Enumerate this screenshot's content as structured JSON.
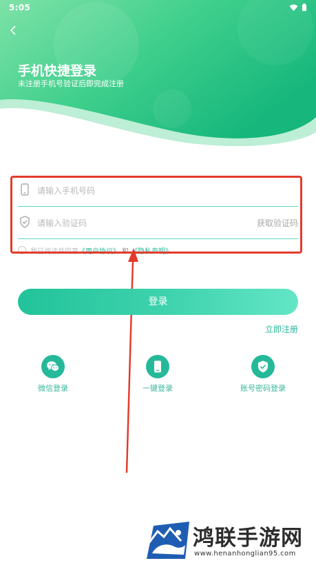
{
  "status_bar": {
    "time": "5:05"
  },
  "header": {
    "title": "手机快捷登录",
    "subtitle": "未注册手机号验证后即完成注册"
  },
  "form": {
    "phone_placeholder": "请输入手机号码",
    "code_placeholder": "请输入验证码",
    "get_code_label": "获取验证码",
    "agreement": {
      "prefix": "我已阅读并同意",
      "user_agreement": "《用户协议》",
      "and": "和",
      "privacy": "《隐私声明》"
    }
  },
  "actions": {
    "login_label": "登录",
    "register_label": "立即注册"
  },
  "alt_login": [
    {
      "label": "微信登录",
      "icon": "wechat-icon"
    },
    {
      "label": "一键登录",
      "icon": "phone-icon"
    },
    {
      "label": "账号密码登录",
      "icon": "shield-check-icon"
    }
  ],
  "watermark": {
    "name": "鸿联手游网",
    "url": "www.henanhonglian95.com"
  },
  "colors": {
    "accent": "#25b99a",
    "annotation": "#e23b2c"
  }
}
